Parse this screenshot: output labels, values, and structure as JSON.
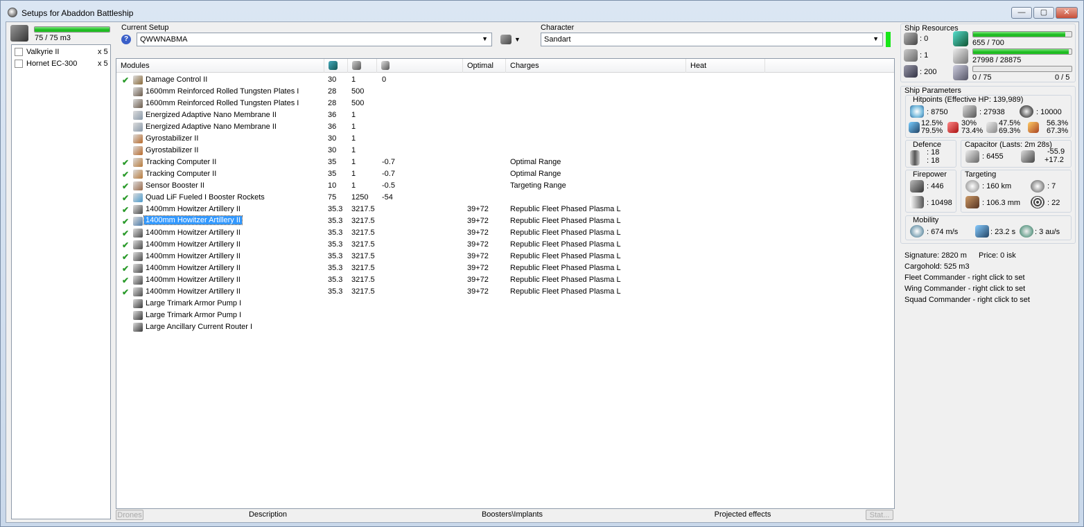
{
  "window": {
    "title": "Setups for Abaddon Battleship",
    "min": "—",
    "max": "▢",
    "close": "✕"
  },
  "drones": {
    "capacity": "75 / 75 m3",
    "capacity_fraction": 1.0,
    "items": [
      {
        "name": "Valkyrie II",
        "qty": "x 5"
      },
      {
        "name": "Hornet EC-300",
        "qty": "x 5"
      }
    ]
  },
  "setup": {
    "label": "Current Setup",
    "value": "QWWNABMA",
    "help": "?"
  },
  "character": {
    "label": "Character",
    "value": "Sandart"
  },
  "modules": {
    "headers": {
      "name": "Modules",
      "optimal": "Optimal",
      "charges": "Charges",
      "heat": "Heat"
    },
    "rows": [
      {
        "check": "✔",
        "name": "Damage Control II",
        "c1": "30",
        "c2": "1",
        "c3": "0",
        "opt": "",
        "charge": "",
        "color": "#8a6a3a"
      },
      {
        "check": "",
        "name": "1600mm Reinforced Rolled Tungsten Plates I",
        "c1": "28",
        "c2": "500",
        "c3": "",
        "opt": "",
        "charge": "",
        "color": "#6a5a4a"
      },
      {
        "check": "",
        "name": "1600mm Reinforced Rolled Tungsten Plates I",
        "c1": "28",
        "c2": "500",
        "c3": "",
        "opt": "",
        "charge": "",
        "color": "#6a5a4a"
      },
      {
        "check": "",
        "name": "Energized Adaptive Nano Membrane II",
        "c1": "36",
        "c2": "1",
        "c3": "",
        "opt": "",
        "charge": "",
        "color": "#8a9aaa"
      },
      {
        "check": "",
        "name": "Energized Adaptive Nano Membrane II",
        "c1": "36",
        "c2": "1",
        "c3": "",
        "opt": "",
        "charge": "",
        "color": "#8a9aaa"
      },
      {
        "check": "",
        "name": "Gyrostabilizer II",
        "c1": "30",
        "c2": "1",
        "c3": "",
        "opt": "",
        "charge": "",
        "color": "#b86a2a"
      },
      {
        "check": "",
        "name": "Gyrostabilizer II",
        "c1": "30",
        "c2": "1",
        "c3": "",
        "opt": "",
        "charge": "",
        "color": "#b86a2a"
      },
      {
        "check": "✔",
        "name": "Tracking Computer II",
        "c1": "35",
        "c2": "1",
        "c3": "-0.7",
        "opt": "",
        "charge": "Optimal Range",
        "color": "#b87a3a"
      },
      {
        "check": "✔",
        "name": "Tracking Computer II",
        "c1": "35",
        "c2": "1",
        "c3": "-0.7",
        "opt": "",
        "charge": "Optimal Range",
        "color": "#b87a3a"
      },
      {
        "check": "✔",
        "name": "Sensor Booster II",
        "c1": "10",
        "c2": "1",
        "c3": "-0.5",
        "opt": "",
        "charge": "Targeting Range",
        "color": "#9a6a4a"
      },
      {
        "check": "✔",
        "name": "Quad LiF Fueled I Booster Rockets",
        "c1": "75",
        "c2": "1250",
        "c3": "-54",
        "opt": "",
        "charge": "",
        "color": "#4a9acc"
      },
      {
        "check": "✔",
        "name": "1400mm Howitzer Artillery II",
        "c1": "35.3",
        "c2": "3217.5",
        "c3": "",
        "opt": "39+72",
        "charge": "Republic Fleet Phased Plasma L",
        "color": "#4a4a4a"
      },
      {
        "check": "✔",
        "name": "1400mm Howitzer Artillery II",
        "c1": "35.3",
        "c2": "3217.5",
        "c3": "",
        "opt": "39+72",
        "charge": "Republic Fleet Phased Plasma L",
        "color": "#4a7aaa",
        "selected": true
      },
      {
        "check": "✔",
        "name": "1400mm Howitzer Artillery II",
        "c1": "35.3",
        "c2": "3217.5",
        "c3": "",
        "opt": "39+72",
        "charge": "Republic Fleet Phased Plasma L",
        "color": "#4a4a4a"
      },
      {
        "check": "✔",
        "name": "1400mm Howitzer Artillery II",
        "c1": "35.3",
        "c2": "3217.5",
        "c3": "",
        "opt": "39+72",
        "charge": "Republic Fleet Phased Plasma L",
        "color": "#4a4a4a"
      },
      {
        "check": "✔",
        "name": "1400mm Howitzer Artillery II",
        "c1": "35.3",
        "c2": "3217.5",
        "c3": "",
        "opt": "39+72",
        "charge": "Republic Fleet Phased Plasma L",
        "color": "#4a4a4a"
      },
      {
        "check": "✔",
        "name": "1400mm Howitzer Artillery II",
        "c1": "35.3",
        "c2": "3217.5",
        "c3": "",
        "opt": "39+72",
        "charge": "Republic Fleet Phased Plasma L",
        "color": "#4a4a4a"
      },
      {
        "check": "✔",
        "name": "1400mm Howitzer Artillery II",
        "c1": "35.3",
        "c2": "3217.5",
        "c3": "",
        "opt": "39+72",
        "charge": "Republic Fleet Phased Plasma L",
        "color": "#4a4a4a"
      },
      {
        "check": "✔",
        "name": "1400mm Howitzer Artillery II",
        "c1": "35.3",
        "c2": "3217.5",
        "c3": "",
        "opt": "39+72",
        "charge": "Republic Fleet Phased Plasma L",
        "color": "#4a4a4a"
      },
      {
        "check": "",
        "name": "Large Trimark Armor Pump I",
        "c1": "",
        "c2": "",
        "c3": "",
        "opt": "",
        "charge": "",
        "color": "#3a3a3a"
      },
      {
        "check": "",
        "name": "Large Trimark Armor Pump I",
        "c1": "",
        "c2": "",
        "c3": "",
        "opt": "",
        "charge": "",
        "color": "#3a3a3a"
      },
      {
        "check": "",
        "name": "Large Ancillary Current Router I",
        "c1": "",
        "c2": "",
        "c3": "",
        "opt": "",
        "charge": "",
        "color": "#3a3a3a"
      }
    ]
  },
  "bottom_tabs": {
    "drones": "Drones",
    "description": "Description",
    "boosters": "Boosters\\Implants",
    "projected": "Projected effects",
    "stats": "Stat..."
  },
  "resources": {
    "title": "Ship Resources",
    "turret": ": 0",
    "launcher": ": 1",
    "calibration": ": 200",
    "cpu": "655 / 700",
    "cpu_fraction": 0.936,
    "power": "27998 / 28875",
    "power_fraction": 0.97,
    "drone_bay": "0 / 75",
    "drone_count": "0 / 5",
    "drone_fraction": 0
  },
  "params": {
    "title": "Ship Parameters",
    "hitpoints_title": "Hitpoints (Effective HP: 139,989)",
    "shield_hp": ": 8750",
    "armor_hp": ": 27938",
    "structure_hp": ": 10000",
    "em_a": "12.5%",
    "em_b": "79.5%",
    "th_a": "30%",
    "th_b": "73.4%",
    "ki_a": "47.5%",
    "ki_b": "69.3%",
    "ex_a": "56.3%",
    "ex_b": "67.3%",
    "defence_title": "Defence",
    "def_a": ": 18",
    "def_b": ": 18",
    "cap_title": "Capacitor (Lasts: 2m 28s)",
    "cap_amount": ": 6455",
    "cap_a": "-55.9",
    "cap_b": "+17.2",
    "firepower_title": "Firepower",
    "dps": ": 446",
    "volley": ": 10498",
    "targeting_title": "Targeting",
    "range": ": 160 km",
    "res": ": 106.3 mm",
    "max_targets": ": 7",
    "sensor": ": 22",
    "mobility_title": "Mobility",
    "speed": ": 674 m/s",
    "align": ": 23.2 s",
    "warp": ": 3 au/s",
    "signature": "Signature: 2820 m",
    "price": "Price: 0 isk",
    "cargo": "Cargohold: 525 m3",
    "fleet_cmd": "Fleet Commander - right click to set",
    "wing_cmd": "Wing Commander - right click to set",
    "squad_cmd": "Squad Commander - right click to set"
  },
  "colors": {
    "accent_green": "#19b81d",
    "selection": "#3399ff"
  }
}
